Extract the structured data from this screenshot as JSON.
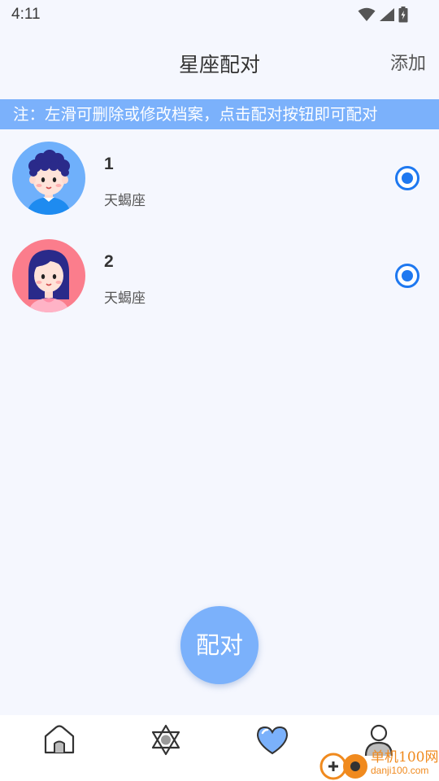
{
  "status_bar": {
    "time": "4:11"
  },
  "header": {
    "title": "星座配对",
    "add_label": "添加"
  },
  "notice": "注：左滑可删除或修改档案，点击配对按钮即可配对",
  "profiles": [
    {
      "name": "1",
      "sign": "天蝎座",
      "avatar": "boy-avatar",
      "selected": true
    },
    {
      "name": "2",
      "sign": "天蝎座",
      "avatar": "girl-avatar",
      "selected": true
    }
  ],
  "match_button": "配对",
  "bottom_nav": [
    {
      "icon": "home-icon"
    },
    {
      "icon": "star-of-david-icon"
    },
    {
      "icon": "heart-icon",
      "active": true
    },
    {
      "icon": "user-icon"
    }
  ],
  "watermark": {
    "text": "单机100网",
    "url": "danji100.com"
  },
  "colors": {
    "accent": "#7bb1fb",
    "radio": "#1e78f0",
    "background": "#f5f7fe"
  }
}
